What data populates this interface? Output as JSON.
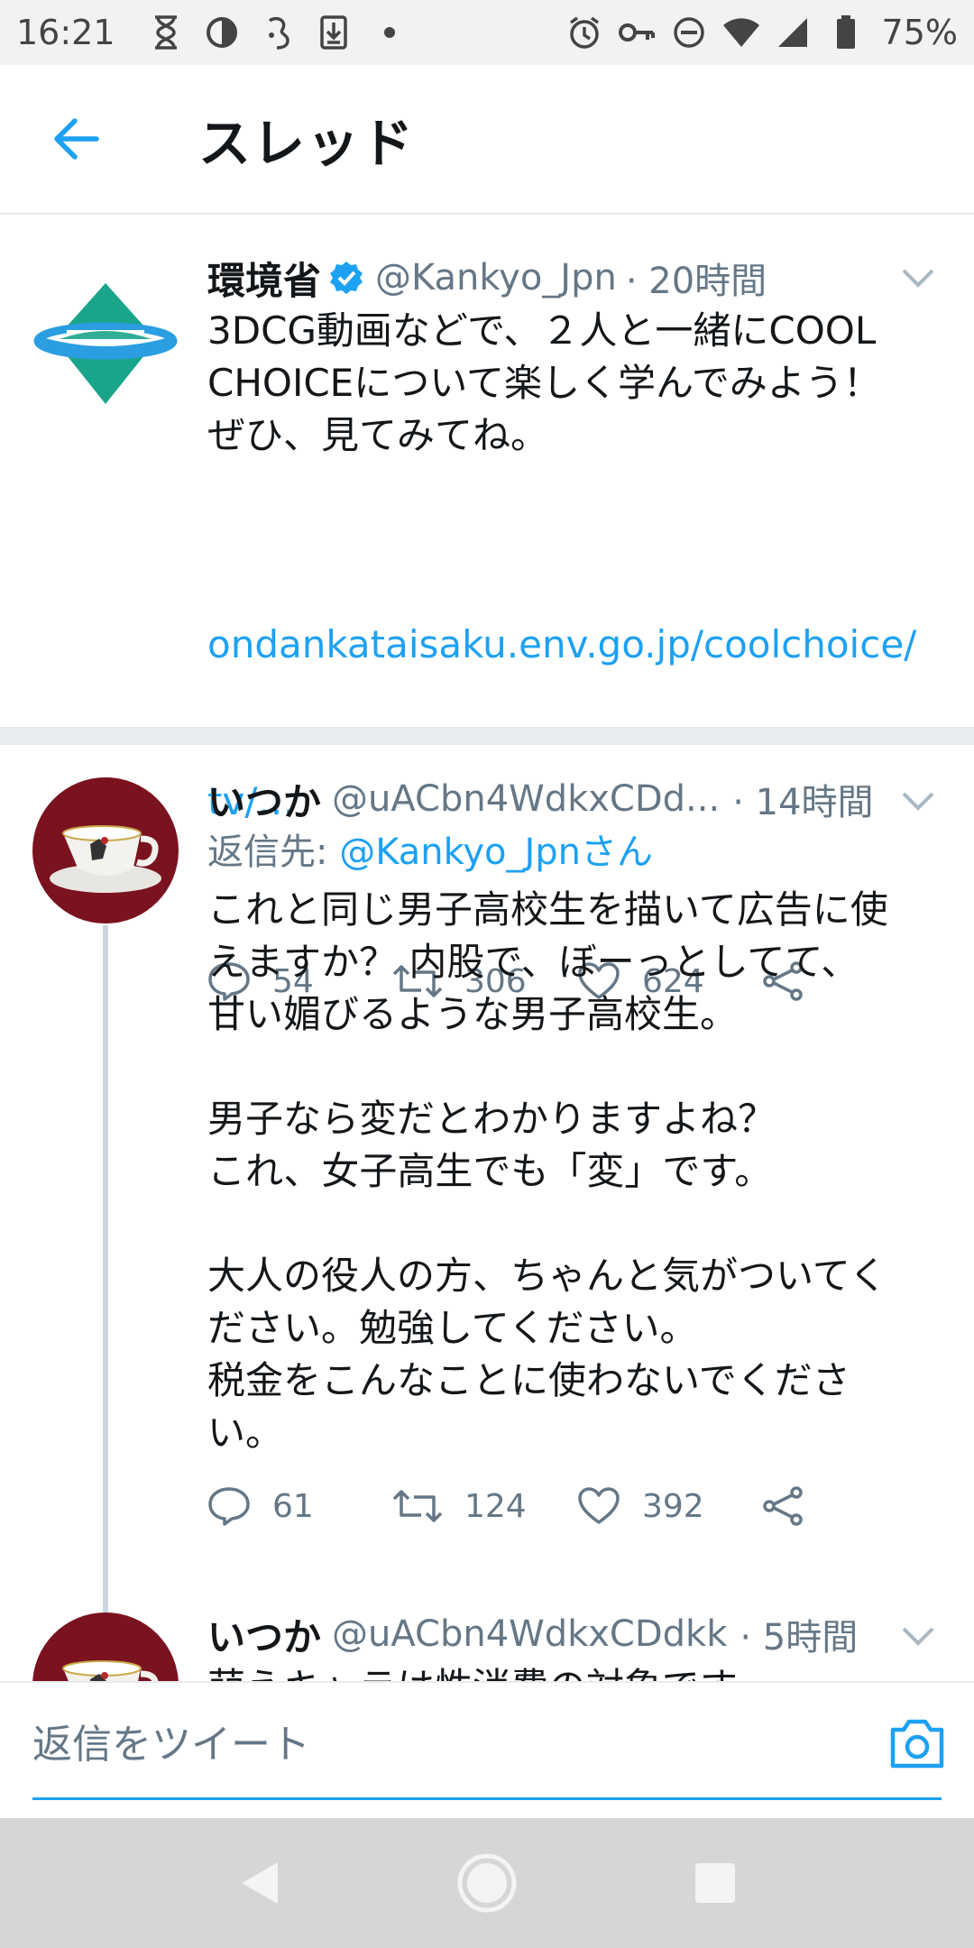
{
  "status_bar": {
    "time": "16:21",
    "battery_percent": "75%",
    "left_icons": [
      "hourglass-icon",
      "data-saver-icon",
      "assistant-icon",
      "download-icon",
      "dot-icon"
    ],
    "right_icons": [
      "alarm-icon",
      "vpn-key-icon",
      "do-not-disturb-icon",
      "wifi-icon",
      "cell-signal-icon",
      "battery-icon"
    ]
  },
  "header": {
    "title": "スレッド",
    "back_icon": "arrow-left-icon"
  },
  "colors": {
    "accent": "#1da1f2",
    "text_secondary": "#657786",
    "divider": "#e6ecf0"
  },
  "tweets": [
    {
      "name": "環境省",
      "verified": true,
      "handle": "@Kankyo_Jpn",
      "time": "· 20時間",
      "text": "3DCG動画などで、２人と一緒にCOOL\nCHOICEについて楽しく学んでみよう！\nぜひ、見てみてね。",
      "link_line1": "ondankataisaku.env.go.jp/coolchoice/",
      "link_line2": "tv/…",
      "replies": "54",
      "retweets": "306",
      "likes": "624"
    },
    {
      "name": "いつか",
      "handle": "@uACbn4WdkxCDd...",
      "time": "· 14時間",
      "reply_to_label": "返信先: ",
      "reply_to_mention": "@Kankyo_Jpnさん",
      "text": "これと同じ男子高校生を描いて広告に使\nえますか？ 内股で、ぼーっとしてて、\n甘い媚びるような男子高校生。\n\n男子なら変だとわかりますよね？\nこれ、女子高生でも「変」です。\n\n大人の役人の方、ちゃんと気がついてく\nださい。勉強してください。\n税金をこんなことに使わないでくださ\nい。",
      "replies": "61",
      "retweets": "124",
      "likes": "392"
    },
    {
      "name": "いつか",
      "handle": "@uACbn4WdkxCDdkk",
      "time": "· 5時間",
      "text": "萌えキャラは性消費の対象です"
    }
  ],
  "reply_bar": {
    "placeholder": "返信をツイート"
  },
  "nav_bar": {
    "icons": [
      "nav-back-icon",
      "nav-home-icon",
      "nav-recents-icon"
    ]
  }
}
